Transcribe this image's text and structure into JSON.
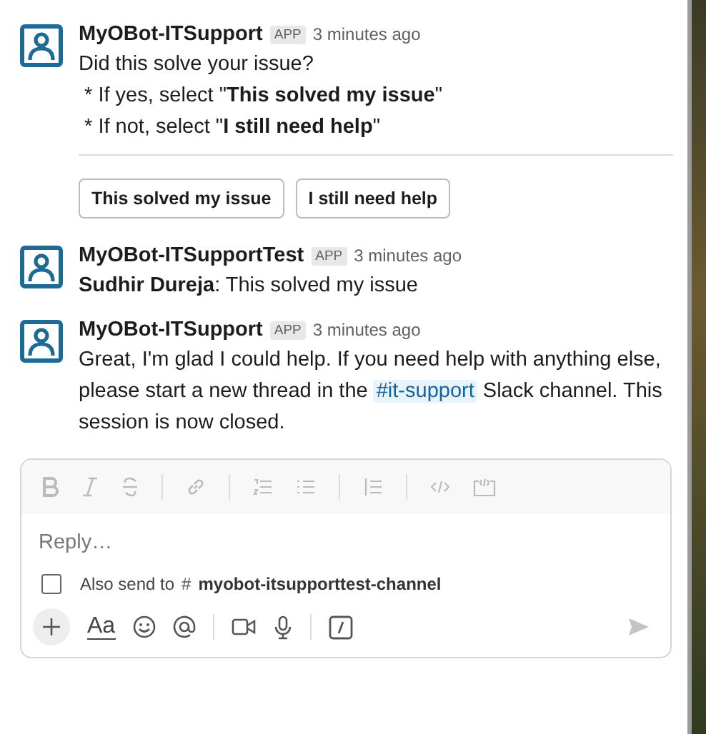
{
  "messages": [
    {
      "kind": "prompt",
      "sender": "MyOBot-ITSupport",
      "badge": "APP",
      "time": "3 minutes ago",
      "lines": [
        "Did this solve your issue?",
        " * If yes, select \"**This solved my issue**\"",
        " * If not, select \"**I still need help**\""
      ],
      "buttons": [
        "This solved my issue",
        "I still need help"
      ]
    },
    {
      "kind": "plain",
      "sender": "MyOBot-ITSupportTest",
      "badge": "APP",
      "time": "3 minutes ago",
      "lines": [
        "**Sudhir Dureja**: This solved my issue"
      ]
    },
    {
      "kind": "link",
      "sender": "MyOBot-ITSupport",
      "badge": "APP",
      "time": "3 minutes ago",
      "before": "Great, I'm glad I could help. If you need help with anything else, please start a new thread in the",
      "channel": "#it-support",
      "after": "Slack channel. This session is now closed."
    }
  ],
  "composer": {
    "placeholder": "Reply…",
    "also_send": {
      "checked": false,
      "label": "Also send to",
      "hash": "#",
      "channel": "myobot-itsupporttest-channel"
    },
    "format_button": "Aa"
  }
}
